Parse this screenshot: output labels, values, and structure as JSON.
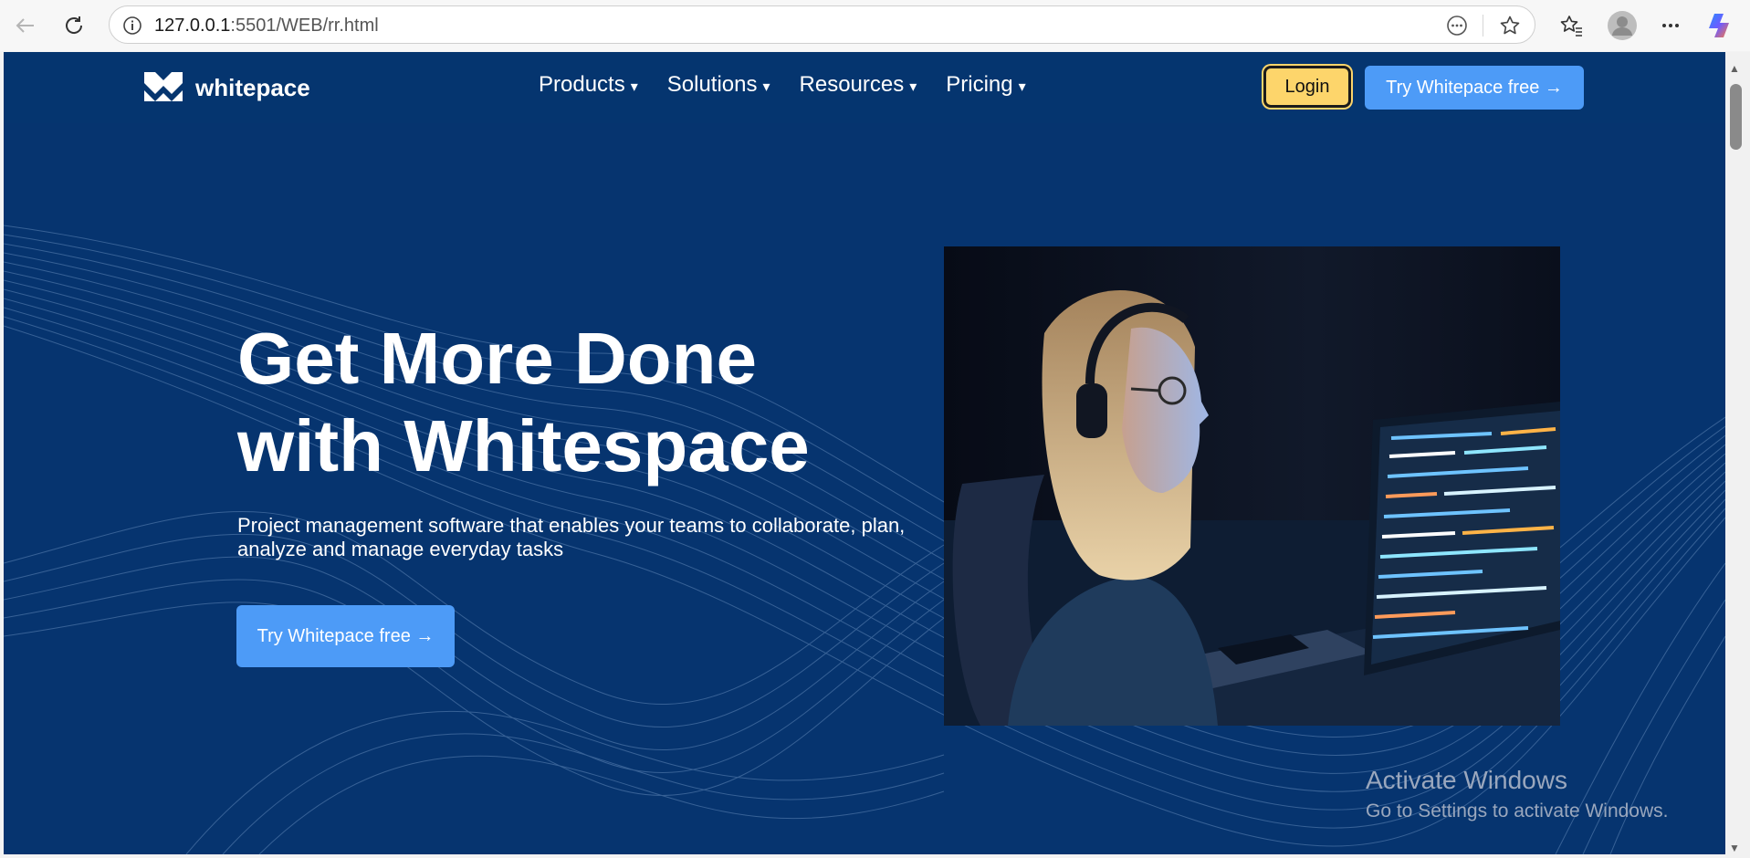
{
  "browser": {
    "url_host": "127.0.0.1",
    "url_rest": ":5501/WEB/rr.html"
  },
  "site": {
    "logo_text": "whitepace",
    "nav": [
      {
        "label": "Products",
        "caret": "▾"
      },
      {
        "label": "Solutions",
        "caret": "▾"
      },
      {
        "label": "Resources",
        "caret": "▾"
      },
      {
        "label": "Pricing",
        "caret": "▾"
      }
    ],
    "login_label": "Login",
    "try_label": "Try Whitepace free →"
  },
  "hero": {
    "title_line1": "Get More Done",
    "title_line2": "with Whitespace",
    "subtitle": "Project management software that enables your teams to collaborate, plan, analyze and manage everyday tasks",
    "cta_label": "Try Whitepace free →"
  },
  "watermark": {
    "line1": "Activate Windows",
    "line2": "Go to Settings to activate Windows."
  },
  "colors": {
    "page_bg": "#06346f",
    "primary_button": "#4d9bf7",
    "login_button": "#fdd56b"
  }
}
